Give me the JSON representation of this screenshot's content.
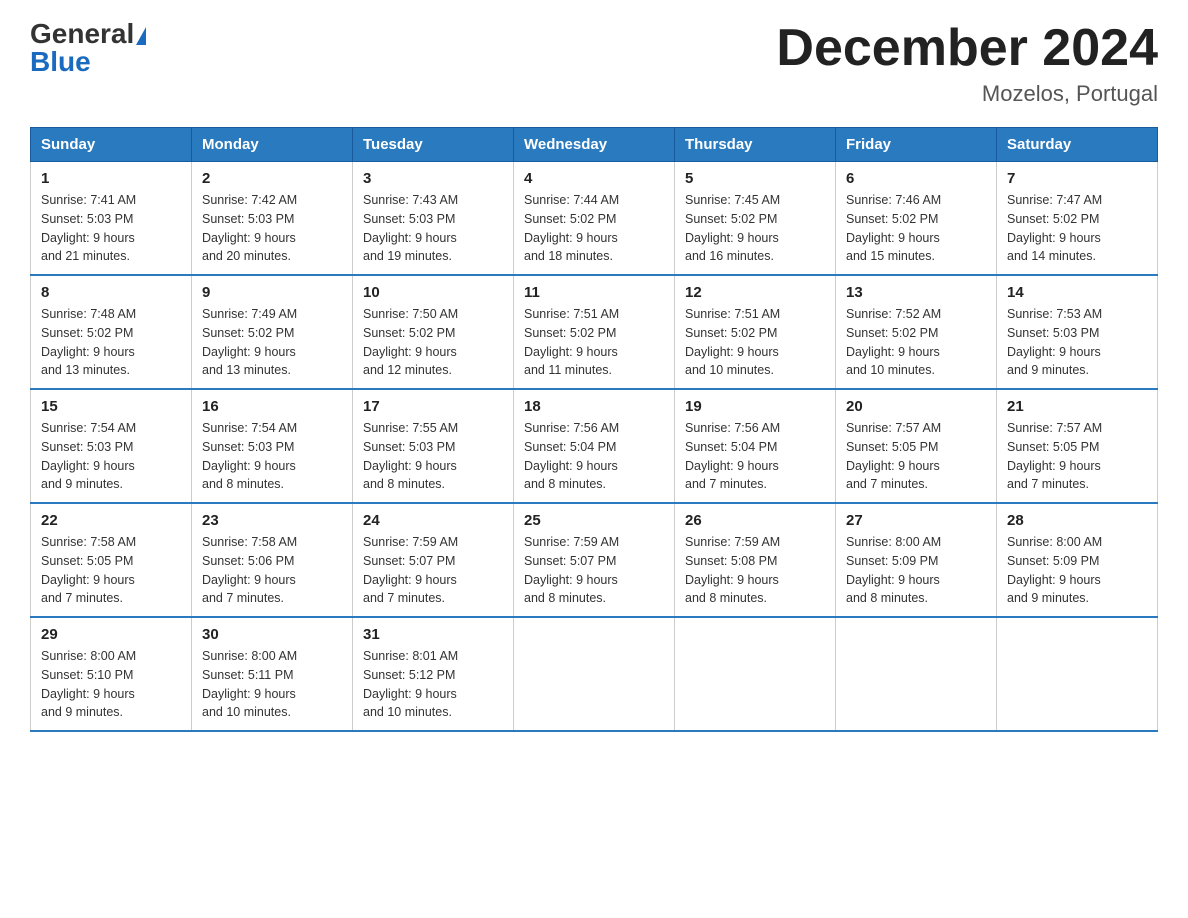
{
  "header": {
    "logo_general": "General",
    "logo_blue": "Blue",
    "month_title": "December 2024",
    "location": "Mozelos, Portugal"
  },
  "days_of_week": [
    "Sunday",
    "Monday",
    "Tuesday",
    "Wednesday",
    "Thursday",
    "Friday",
    "Saturday"
  ],
  "weeks": [
    [
      {
        "day": "1",
        "sunrise": "7:41 AM",
        "sunset": "5:03 PM",
        "daylight": "9 hours and 21 minutes."
      },
      {
        "day": "2",
        "sunrise": "7:42 AM",
        "sunset": "5:03 PM",
        "daylight": "9 hours and 20 minutes."
      },
      {
        "day": "3",
        "sunrise": "7:43 AM",
        "sunset": "5:03 PM",
        "daylight": "9 hours and 19 minutes."
      },
      {
        "day": "4",
        "sunrise": "7:44 AM",
        "sunset": "5:02 PM",
        "daylight": "9 hours and 18 minutes."
      },
      {
        "day": "5",
        "sunrise": "7:45 AM",
        "sunset": "5:02 PM",
        "daylight": "9 hours and 16 minutes."
      },
      {
        "day": "6",
        "sunrise": "7:46 AM",
        "sunset": "5:02 PM",
        "daylight": "9 hours and 15 minutes."
      },
      {
        "day": "7",
        "sunrise": "7:47 AM",
        "sunset": "5:02 PM",
        "daylight": "9 hours and 14 minutes."
      }
    ],
    [
      {
        "day": "8",
        "sunrise": "7:48 AM",
        "sunset": "5:02 PM",
        "daylight": "9 hours and 13 minutes."
      },
      {
        "day": "9",
        "sunrise": "7:49 AM",
        "sunset": "5:02 PM",
        "daylight": "9 hours and 13 minutes."
      },
      {
        "day": "10",
        "sunrise": "7:50 AM",
        "sunset": "5:02 PM",
        "daylight": "9 hours and 12 minutes."
      },
      {
        "day": "11",
        "sunrise": "7:51 AM",
        "sunset": "5:02 PM",
        "daylight": "9 hours and 11 minutes."
      },
      {
        "day": "12",
        "sunrise": "7:51 AM",
        "sunset": "5:02 PM",
        "daylight": "9 hours and 10 minutes."
      },
      {
        "day": "13",
        "sunrise": "7:52 AM",
        "sunset": "5:02 PM",
        "daylight": "9 hours and 10 minutes."
      },
      {
        "day": "14",
        "sunrise": "7:53 AM",
        "sunset": "5:03 PM",
        "daylight": "9 hours and 9 minutes."
      }
    ],
    [
      {
        "day": "15",
        "sunrise": "7:54 AM",
        "sunset": "5:03 PM",
        "daylight": "9 hours and 9 minutes."
      },
      {
        "day": "16",
        "sunrise": "7:54 AM",
        "sunset": "5:03 PM",
        "daylight": "9 hours and 8 minutes."
      },
      {
        "day": "17",
        "sunrise": "7:55 AM",
        "sunset": "5:03 PM",
        "daylight": "9 hours and 8 minutes."
      },
      {
        "day": "18",
        "sunrise": "7:56 AM",
        "sunset": "5:04 PM",
        "daylight": "9 hours and 8 minutes."
      },
      {
        "day": "19",
        "sunrise": "7:56 AM",
        "sunset": "5:04 PM",
        "daylight": "9 hours and 7 minutes."
      },
      {
        "day": "20",
        "sunrise": "7:57 AM",
        "sunset": "5:05 PM",
        "daylight": "9 hours and 7 minutes."
      },
      {
        "day": "21",
        "sunrise": "7:57 AM",
        "sunset": "5:05 PM",
        "daylight": "9 hours and 7 minutes."
      }
    ],
    [
      {
        "day": "22",
        "sunrise": "7:58 AM",
        "sunset": "5:05 PM",
        "daylight": "9 hours and 7 minutes."
      },
      {
        "day": "23",
        "sunrise": "7:58 AM",
        "sunset": "5:06 PM",
        "daylight": "9 hours and 7 minutes."
      },
      {
        "day": "24",
        "sunrise": "7:59 AM",
        "sunset": "5:07 PM",
        "daylight": "9 hours and 7 minutes."
      },
      {
        "day": "25",
        "sunrise": "7:59 AM",
        "sunset": "5:07 PM",
        "daylight": "9 hours and 8 minutes."
      },
      {
        "day": "26",
        "sunrise": "7:59 AM",
        "sunset": "5:08 PM",
        "daylight": "9 hours and 8 minutes."
      },
      {
        "day": "27",
        "sunrise": "8:00 AM",
        "sunset": "5:09 PM",
        "daylight": "9 hours and 8 minutes."
      },
      {
        "day": "28",
        "sunrise": "8:00 AM",
        "sunset": "5:09 PM",
        "daylight": "9 hours and 9 minutes."
      }
    ],
    [
      {
        "day": "29",
        "sunrise": "8:00 AM",
        "sunset": "5:10 PM",
        "daylight": "9 hours and 9 minutes."
      },
      {
        "day": "30",
        "sunrise": "8:00 AM",
        "sunset": "5:11 PM",
        "daylight": "9 hours and 10 minutes."
      },
      {
        "day": "31",
        "sunrise": "8:01 AM",
        "sunset": "5:12 PM",
        "daylight": "9 hours and 10 minutes."
      },
      null,
      null,
      null,
      null
    ]
  ]
}
